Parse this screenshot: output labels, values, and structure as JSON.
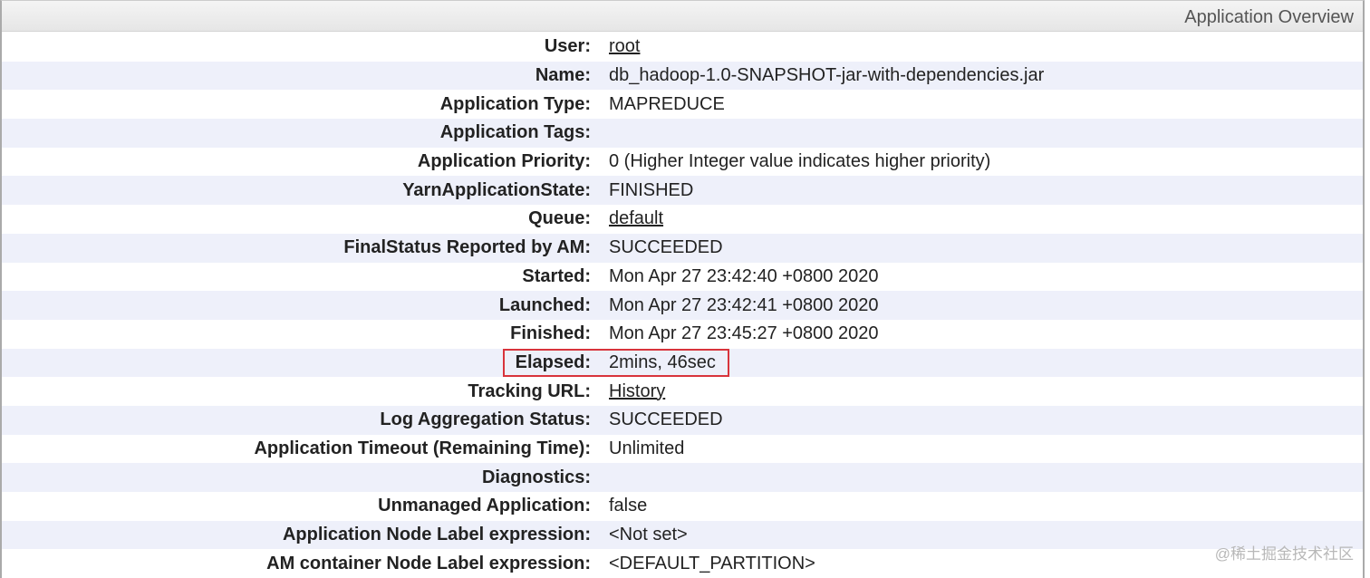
{
  "header": {
    "title": "Application Overview"
  },
  "rows": [
    {
      "label": "User:",
      "value": "root",
      "link": true
    },
    {
      "label": "Name:",
      "value": "db_hadoop-1.0-SNAPSHOT-jar-with-dependencies.jar"
    },
    {
      "label": "Application Type:",
      "value": "MAPREDUCE"
    },
    {
      "label": "Application Tags:",
      "value": ""
    },
    {
      "label": "Application Priority:",
      "value": "0 (Higher Integer value indicates higher priority)"
    },
    {
      "label": "YarnApplicationState:",
      "value": "FINISHED"
    },
    {
      "label": "Queue:",
      "value": "default",
      "link": true
    },
    {
      "label": "FinalStatus Reported by AM:",
      "value": "SUCCEEDED"
    },
    {
      "label": "Started:",
      "value": "Mon Apr 27 23:42:40 +0800 2020"
    },
    {
      "label": "Launched:",
      "value": "Mon Apr 27 23:42:41 +0800 2020"
    },
    {
      "label": "Finished:",
      "value": "Mon Apr 27 23:45:27 +0800 2020"
    },
    {
      "label": "Elapsed:",
      "value": "2mins, 46sec"
    },
    {
      "label": "Tracking URL:",
      "value": "History",
      "link": true
    },
    {
      "label": "Log Aggregation Status:",
      "value": "SUCCEEDED"
    },
    {
      "label": "Application Timeout (Remaining Time):",
      "value": "Unlimited"
    },
    {
      "label": "Diagnostics:",
      "value": ""
    },
    {
      "label": "Unmanaged Application:",
      "value": "false"
    },
    {
      "label": "Application Node Label expression:",
      "value": "<Not set>"
    },
    {
      "label": "AM container Node Label expression:",
      "value": "<DEFAULT_PARTITION>"
    }
  ],
  "watermark": "@稀土掘金技术社区",
  "colors": {
    "highlight": "#d8343c",
    "alt_row": "#eef0fa"
  }
}
